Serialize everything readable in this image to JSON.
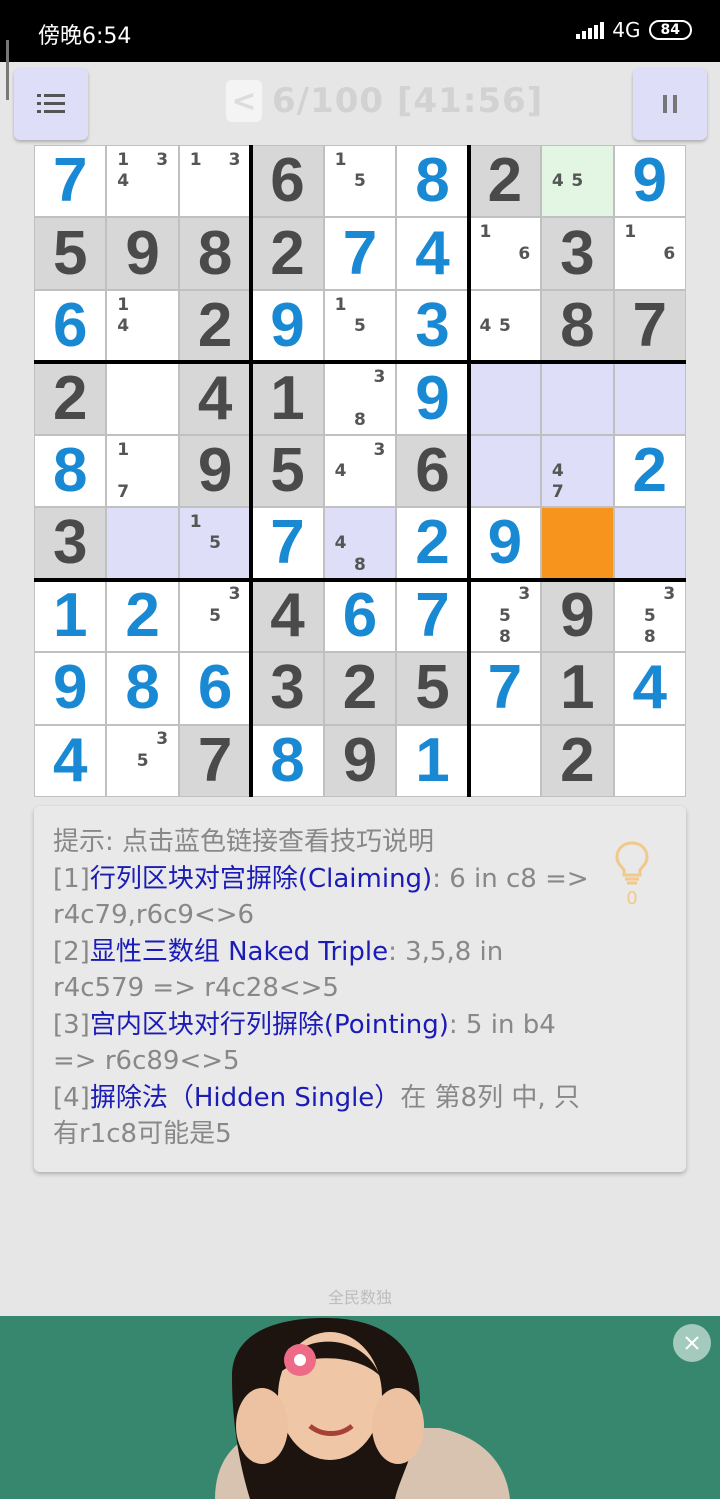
{
  "status": {
    "time": "傍晚6:54",
    "network": "4G",
    "battery": "84"
  },
  "header": {
    "menu_icon": "menu-icon",
    "back_label": "<",
    "title": "6/100 [41:56]",
    "pause_label": "II"
  },
  "grid": {
    "values": [
      [
        7,
        0,
        0,
        6,
        0,
        8,
        2,
        0,
        9
      ],
      [
        5,
        9,
        8,
        2,
        7,
        4,
        0,
        3,
        0
      ],
      [
        6,
        0,
        2,
        9,
        0,
        3,
        0,
        8,
        7
      ],
      [
        2,
        0,
        4,
        1,
        0,
        9,
        0,
        0,
        0
      ],
      [
        8,
        0,
        9,
        5,
        0,
        6,
        0,
        0,
        2
      ],
      [
        3,
        0,
        0,
        7,
        0,
        2,
        9,
        0,
        0
      ],
      [
        1,
        2,
        0,
        4,
        6,
        7,
        0,
        9,
        0
      ],
      [
        9,
        8,
        6,
        3,
        2,
        5,
        7,
        1,
        4
      ],
      [
        4,
        0,
        7,
        8,
        9,
        1,
        0,
        2,
        0
      ]
    ],
    "given": [
      [
        false,
        false,
        false,
        true,
        false,
        false,
        true,
        false,
        false
      ],
      [
        true,
        true,
        true,
        true,
        false,
        false,
        false,
        true,
        false
      ],
      [
        false,
        false,
        true,
        false,
        false,
        false,
        false,
        true,
        true
      ],
      [
        true,
        false,
        true,
        true,
        false,
        false,
        false,
        false,
        false
      ],
      [
        false,
        false,
        true,
        true,
        false,
        true,
        false,
        false,
        false
      ],
      [
        true,
        false,
        false,
        false,
        false,
        false,
        false,
        false,
        false
      ],
      [
        false,
        false,
        false,
        true,
        false,
        false,
        false,
        true,
        false
      ],
      [
        false,
        false,
        false,
        true,
        true,
        true,
        false,
        true,
        false
      ],
      [
        false,
        false,
        true,
        false,
        true,
        false,
        false,
        true,
        false
      ]
    ],
    "notes": [
      [
        [],
        [
          1,
          3,
          4
        ],
        [
          1,
          3
        ],
        [],
        [
          1,
          5
        ],
        [],
        [],
        [
          4,
          5
        ],
        []
      ],
      [
        [],
        [],
        [],
        [],
        [],
        [],
        [
          1,
          6
        ],
        [],
        [
          1,
          6
        ]
      ],
      [
        [],
        [
          1,
          4
        ],
        [],
        [],
        [
          1,
          5
        ],
        [],
        [
          4,
          5
        ],
        [],
        []
      ],
      [
        [],
        [],
        [],
        [],
        [
          3,
          8
        ],
        [],
        [],
        [],
        []
      ],
      [
        [],
        [
          1,
          7
        ],
        [],
        [],
        [
          3,
          4
        ],
        [],
        [],
        [
          4,
          7
        ],
        []
      ],
      [
        [],
        [],
        [
          1,
          5
        ],
        [],
        [
          4,
          8
        ],
        [],
        [],
        [],
        []
      ],
      [
        [],
        [],
        [
          3,
          5
        ],
        [],
        [],
        [],
        [
          3,
          5,
          8
        ],
        [],
        [
          3,
          5,
          8
        ]
      ],
      [
        [],
        [],
        [],
        [],
        [],
        [],
        [],
        [],
        []
      ],
      [
        [],
        [
          3,
          5
        ],
        [],
        [],
        [],
        [],
        [],
        [],
        []
      ]
    ],
    "highlight_rows": [
      5
    ],
    "highlight_cols": [
      7
    ],
    "highlight_boxes": [
      5
    ],
    "selected": [
      5,
      7
    ],
    "hint_cell": [
      0,
      7
    ],
    "colors": {
      "given_bg": "#d7d7d7",
      "given_fg": "#4a4a4a",
      "filled_fg": "#1a89d4",
      "blank_bg": "#ffffff",
      "highlight_bg": "#dedef9",
      "selected_bg": "#f7941d",
      "hint_bg": "#e3f6e3"
    }
  },
  "hint": {
    "prefix": "提示: 点击蓝色链接查看技巧说明",
    "items": [
      {
        "tag": "[1]",
        "link": "行列区块对宫摒除(Claiming)",
        "text": ": 6 in c8 => r4c79,r6c9<>6"
      },
      {
        "tag": "[2]",
        "link": "显性三数组 Naked Triple",
        "text": ": 3,5,8 in r4c579 => r4c28<>5"
      },
      {
        "tag": "[3]",
        "link": "宫内区块对行列摒除(Pointing)",
        "text": ": 5 in b4 => r6c89<>5"
      },
      {
        "tag": "[4]",
        "link": "摒除法（Hidden Single）",
        "text": "在 第8列 中, 只有r1c8可能是5"
      }
    ],
    "bulb_count": "0",
    "bulb_icon": "lightbulb-icon"
  },
  "footer": {
    "brand": "全民数独"
  }
}
